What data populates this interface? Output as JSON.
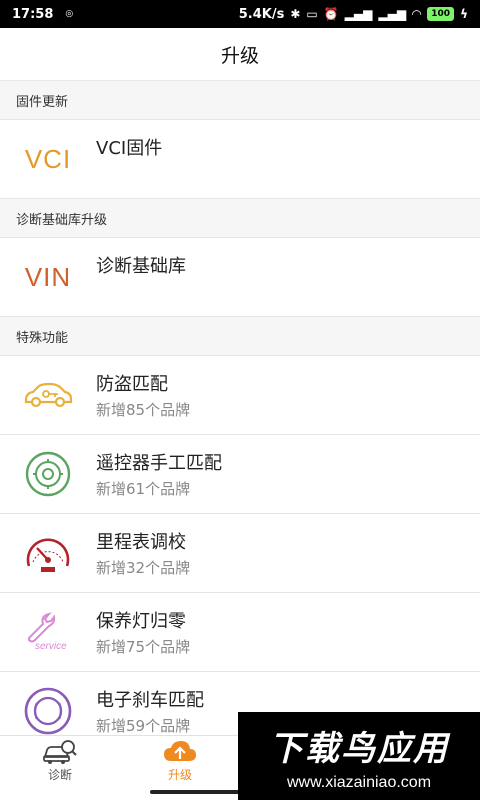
{
  "status_bar": {
    "time": "17:58",
    "speed": "5.4K/s",
    "battery": "100"
  },
  "header": {
    "title": "升级"
  },
  "sections": {
    "firmware": {
      "label": "固件更新"
    },
    "database": {
      "label": "诊断基础库升级"
    },
    "special": {
      "label": "特殊功能"
    }
  },
  "items": {
    "vci": {
      "logo": "VCI",
      "title": "VCI固件"
    },
    "vin": {
      "logo": "VIN",
      "title": "诊断基础库"
    },
    "immo": {
      "title": "防盗匹配",
      "subtitle": "新增85个品牌"
    },
    "remote": {
      "title": "遥控器手工匹配",
      "subtitle": "新增61个品牌"
    },
    "odometer": {
      "title": "里程表调校",
      "subtitle": "新增32个品牌"
    },
    "service": {
      "title": "保养灯归零",
      "subtitle": "新增75个品牌",
      "icon_text": "service"
    },
    "epb": {
      "title": "电子刹车匹配",
      "subtitle": "新增59个品牌"
    }
  },
  "bottom_nav": {
    "diagnose": "诊断",
    "upgrade": "升级"
  },
  "watermark": {
    "main": "下载鸟应用",
    "url": "www.xiazainiao.com"
  },
  "colors": {
    "accent": "#f08a20",
    "vci": "#e49a2a",
    "vin": "#d0602c",
    "immo": "#e8b23a",
    "remote": "#5aa45f",
    "odometer": "#b1242a",
    "service": "#d98ad6",
    "epb": "#8b5bb5"
  }
}
